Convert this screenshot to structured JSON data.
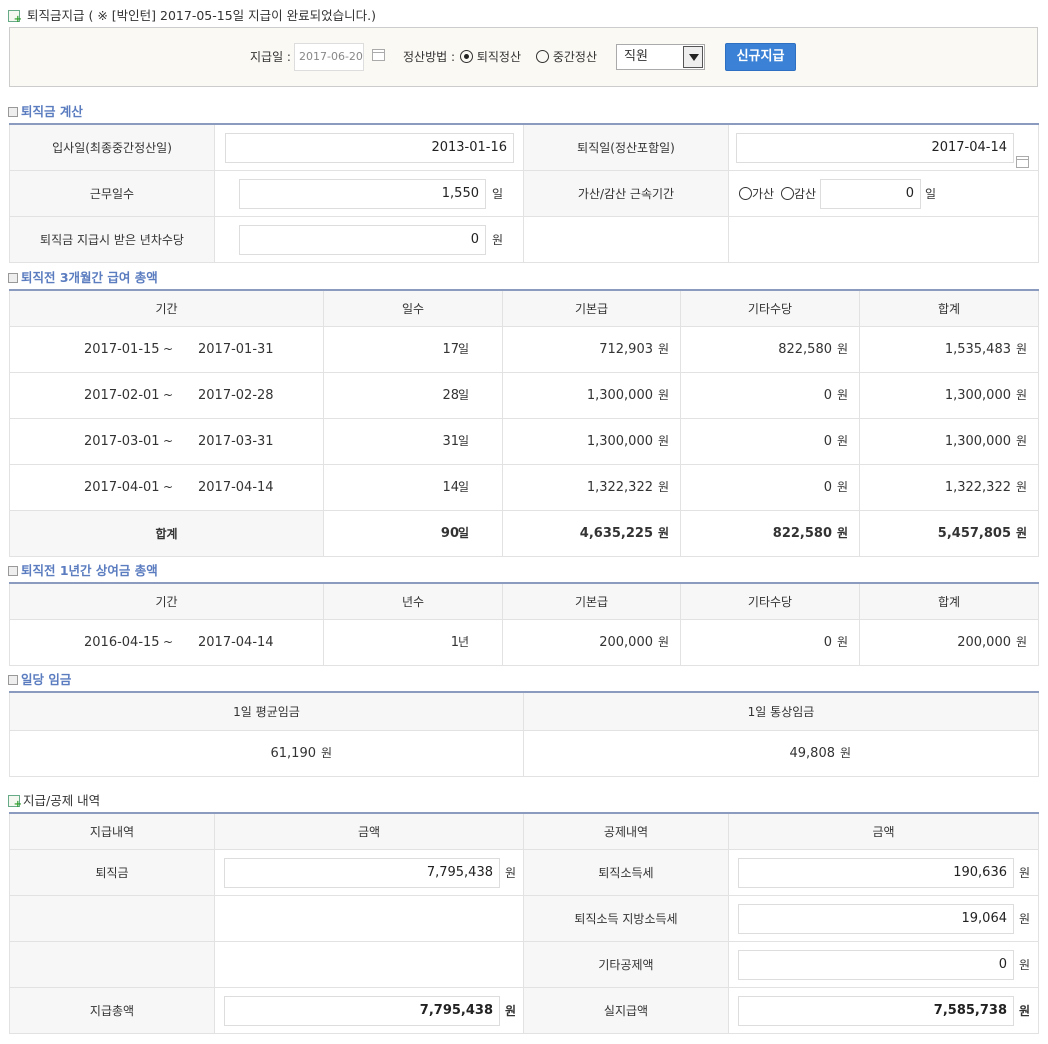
{
  "header": {
    "title": "퇴직금지급",
    "notice": "( ※ [박인턴] 2017-05-15일  지급이 완료되었습니다.)"
  },
  "filters": {
    "pay_date_label": "지급일 :",
    "pay_date_value": "2017-06-20",
    "method_label": "정산방법 :",
    "method_options": [
      "퇴직정산",
      "중간정산"
    ],
    "selected_method": "퇴직정산",
    "role_value": "직원",
    "new_button_label": "신규지급"
  },
  "calc": {
    "section_title": "퇴직금 계산",
    "join_label": "입사일(최종중간정산일)",
    "join_value": "2013-01-16",
    "retire_label": "퇴직일(정산포함일)",
    "retire_value": "2017-04-14",
    "workdays_label": "근무일수",
    "workdays_value": "1,550",
    "workdays_unit": "일",
    "adjust_label": "가산/감산 근속기간",
    "adjust_plus": "가산",
    "adjust_minus": "감산",
    "adjust_value": "0",
    "adjust_unit": "일",
    "leave_label": "퇴직금 지급시 받은 년차수당",
    "leave_value": "0",
    "leave_unit": "원"
  },
  "three_month": {
    "section_title": "퇴직전 3개월간 급여 총액",
    "headers": [
      "기간",
      "일수",
      "기본급",
      "기타수당",
      "합계"
    ],
    "rows": [
      {
        "from": "2017-01-15",
        "to": "2017-01-31",
        "days": "17",
        "base": "712,903",
        "etc": "822,580",
        "total": "1,535,483"
      },
      {
        "from": "2017-02-01",
        "to": "2017-02-28",
        "days": "28",
        "base": "1,300,000",
        "etc": "0",
        "total": "1,300,000"
      },
      {
        "from": "2017-03-01",
        "to": "2017-03-31",
        "days": "31",
        "base": "1,300,000",
        "etc": "0",
        "total": "1,300,000"
      },
      {
        "from": "2017-04-01",
        "to": "2017-04-14",
        "days": "14",
        "base": "1,322,322",
        "etc": "0",
        "total": "1,322,322"
      }
    ],
    "sum": {
      "label": "합계",
      "days": "90",
      "base": "4,635,225",
      "etc": "822,580",
      "total": "5,457,805"
    },
    "tilde": "~",
    "day_unit": "일",
    "won_unit": "원"
  },
  "one_year": {
    "section_title": "퇴직전 1년간 상여금 총액",
    "headers": [
      "기간",
      "년수",
      "기본급",
      "기타수당",
      "합계"
    ],
    "row": {
      "from": "2016-04-15",
      "to": "2017-04-14",
      "years": "1",
      "base": "200,000",
      "etc": "0",
      "total": "200,000"
    },
    "year_unit": "년"
  },
  "daily": {
    "section_title": "일당 임금",
    "avg_label": "1일 평균임금",
    "avg_value": "61,190",
    "normal_label": "1일 통상임금",
    "normal_value": "49,808"
  },
  "payment": {
    "section_title": "지급/공제 내역",
    "headers": [
      "지급내역",
      "금액",
      "공제내역",
      "금액"
    ],
    "severance_label": "퇴직금",
    "severance_value": "7,795,438",
    "tax_label": "퇴직소득세",
    "tax_value": "190,636",
    "local_tax_label": "퇴직소득 지방소득세",
    "local_tax_value": "19,064",
    "other_label": "기타공제액",
    "other_value": "0",
    "total_pay_label": "지급총액",
    "total_pay_value": "7,795,438",
    "net_label": "실지급액",
    "net_value": "7,585,738"
  }
}
